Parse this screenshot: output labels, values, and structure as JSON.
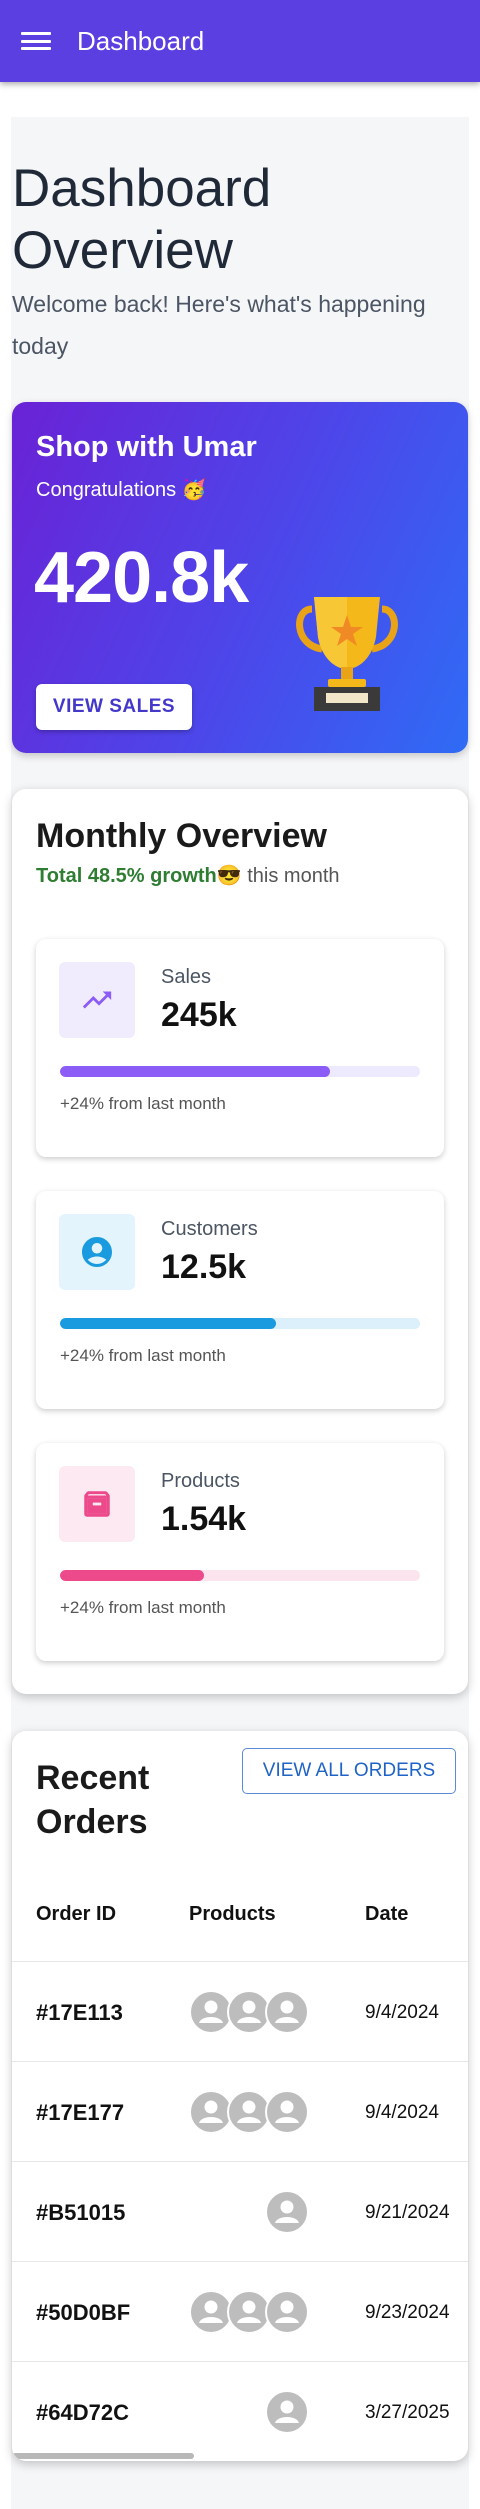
{
  "appbar": {
    "title": "Dashboard"
  },
  "page": {
    "title": "Dashboard Overview",
    "welcome": "Welcome back! Here's what's happening today"
  },
  "hero": {
    "title": "Shop with Umar",
    "subtitle": "Congratulations 🥳",
    "value": "420.8k",
    "button_label": "VIEW SALES"
  },
  "overview": {
    "title": "Monthly Overview",
    "growth_text": "Total 48.5% growth",
    "growth_emoji": "😎",
    "suffix": " this month",
    "stats": [
      {
        "label": "Sales",
        "value": "245k",
        "note": "+24% from last month",
        "progress": 0.75,
        "icon": "trending-up-icon",
        "color": "#8b5cf6",
        "track": "#ede9fe",
        "icon_bg": "#f1ecfd"
      },
      {
        "label": "Customers",
        "value": "12.5k",
        "note": "+24% from last month",
        "progress": 0.6,
        "icon": "account-circle-icon",
        "color": "#1a9be0",
        "track": "#dbf0fb",
        "icon_bg": "#e3f4fc"
      },
      {
        "label": "Products",
        "value": "1.54k",
        "note": "+24% from last month",
        "progress": 0.4,
        "icon": "archive-box-icon",
        "color": "#ec4a8a",
        "track": "#fce4ee",
        "icon_bg": "#fde9f1"
      }
    ]
  },
  "orders": {
    "title": "Recent Orders",
    "button_label": "VIEW ALL ORDERS",
    "columns": [
      "Order ID",
      "Products",
      "Date"
    ],
    "rows": [
      {
        "id": "#17E113",
        "avatars": 3,
        "date": "9/4/2024"
      },
      {
        "id": "#17E177",
        "avatars": 3,
        "date": "9/4/2024"
      },
      {
        "id": "#B51015",
        "avatars": 1,
        "date": "9/21/2024"
      },
      {
        "id": "#50D0BF",
        "avatars": 3,
        "date": "9/23/2024"
      },
      {
        "id": "#64D72C",
        "avatars": 1,
        "date": "3/27/2025"
      }
    ]
  }
}
